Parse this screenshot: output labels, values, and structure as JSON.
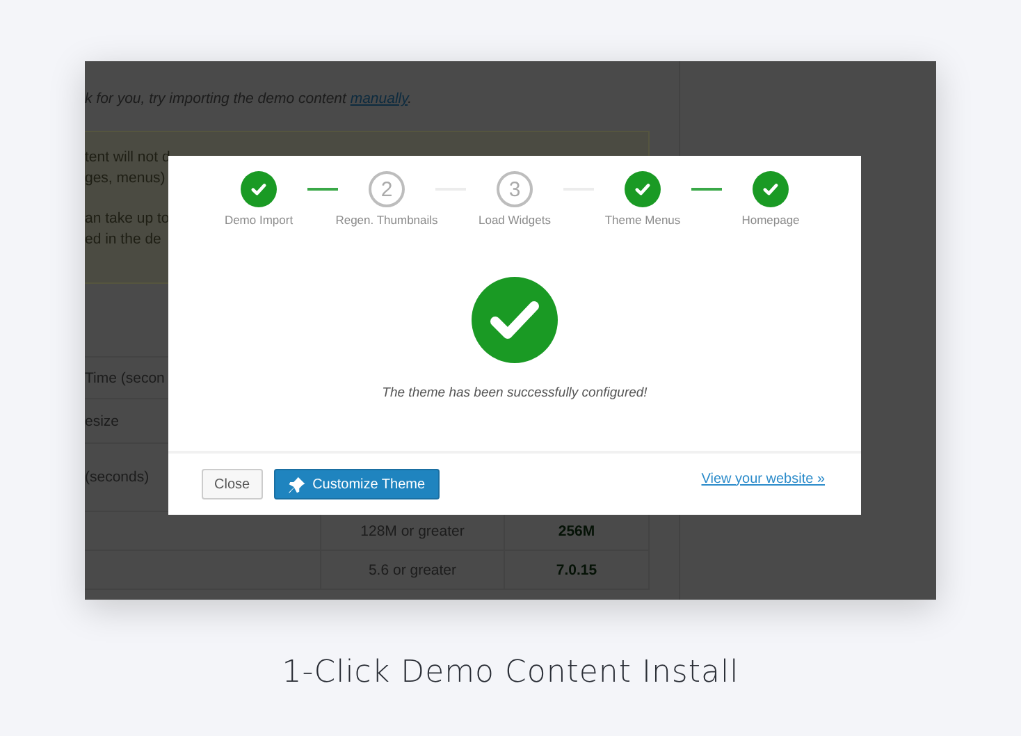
{
  "background_page": {
    "intro": {
      "before": "k for you, try importing the demo content ",
      "link": "manually",
      "after": "."
    },
    "notice_lines": [
      "tent will not d",
      "ges, menus)",
      "an take up to",
      "ed in the de"
    ],
    "table_rows": [
      {
        "label": "",
        "required": "",
        "current": ""
      },
      {
        "label": "Time (secon",
        "required": "",
        "current": ""
      },
      {
        "label": "esize",
        "required": "",
        "current": ""
      },
      {
        "label": "(seconds)",
        "required": "",
        "current": ""
      },
      {
        "label": "",
        "required": "128M or greater",
        "current": "256M"
      },
      {
        "label": "",
        "required": "5.6 or greater",
        "current": "7.0.15"
      }
    ]
  },
  "modal": {
    "steps": [
      {
        "label": "Demo Import",
        "done": true
      },
      {
        "label": "Regen. Thumbnails",
        "done": false,
        "number": "2"
      },
      {
        "label": "Load Widgets",
        "done": false,
        "number": "3"
      },
      {
        "label": "Theme Menus",
        "done": true
      },
      {
        "label": "Homepage",
        "done": true
      }
    ],
    "connectors": [
      {
        "done": true
      },
      {
        "done": false
      },
      {
        "done": false
      },
      {
        "done": true
      }
    ],
    "message": "The theme has been successfully configured!",
    "buttons": [
      {
        "label": "Close",
        "kind": "secondary"
      },
      {
        "label": "Customize Theme",
        "kind": "primary"
      }
    ],
    "link": "View your website »"
  },
  "caption": "1-Click Demo Content Install"
}
